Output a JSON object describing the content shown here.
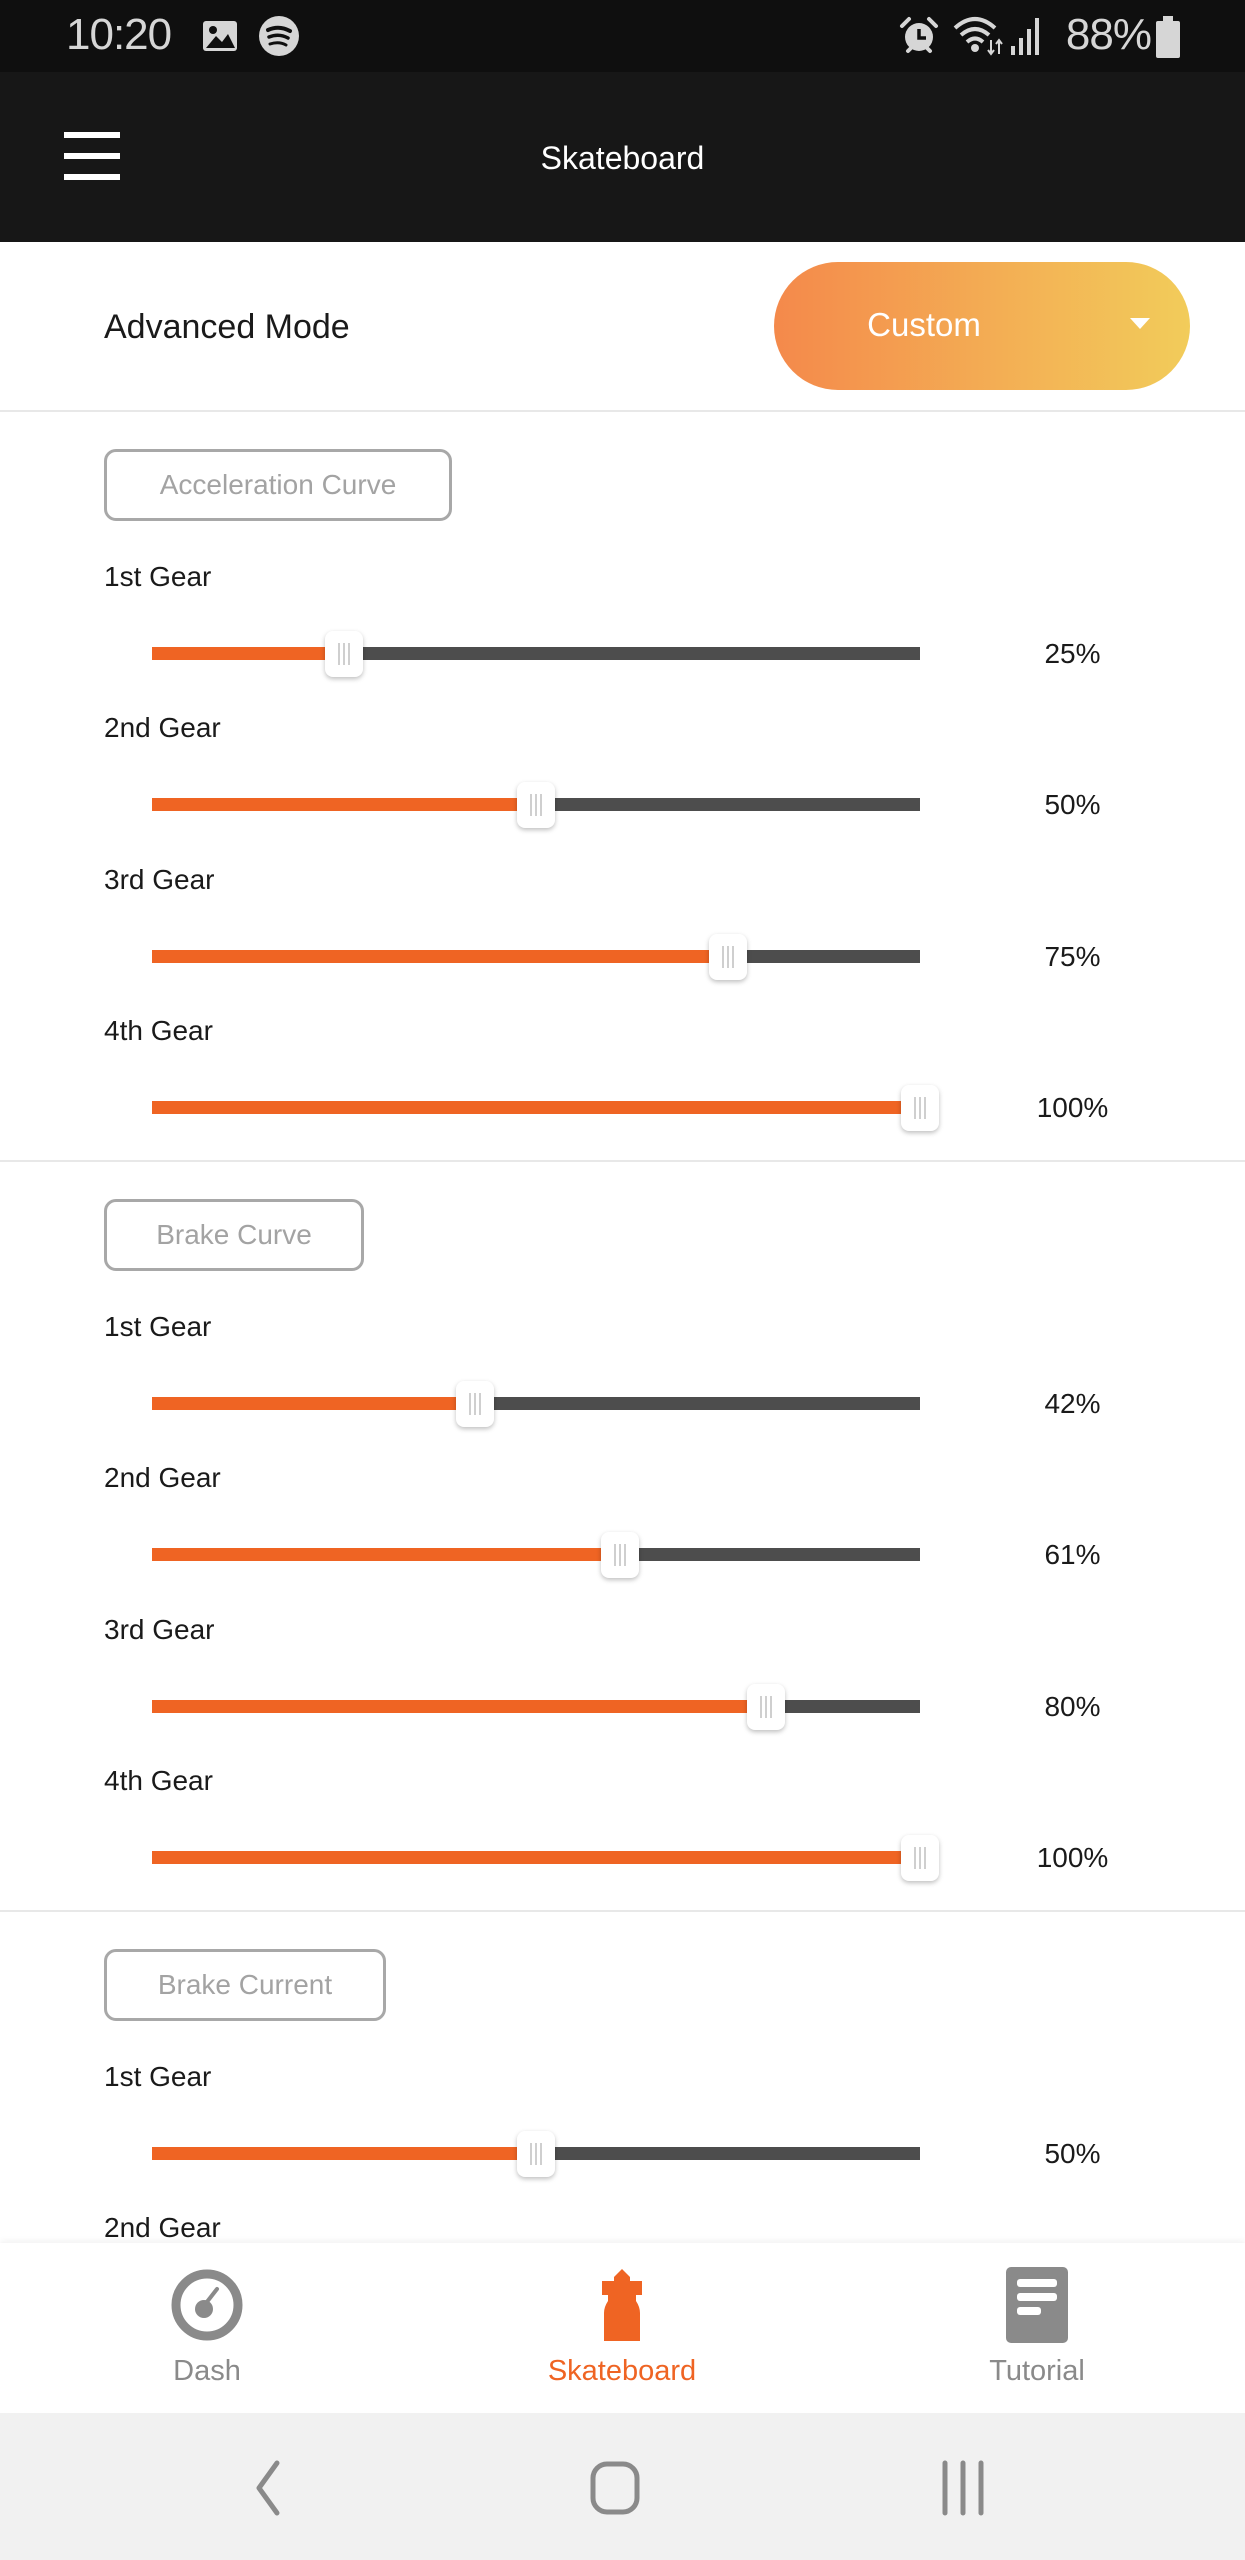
{
  "status_bar": {
    "time": "10:20",
    "battery_percent": "88%",
    "icons": [
      "gallery-icon",
      "spotify-icon",
      "alarm-icon",
      "wifi-icon",
      "signal-icon",
      "battery-icon"
    ]
  },
  "app_bar": {
    "title": "Skateboard",
    "menu_icon": "hamburger-menu-icon"
  },
  "advanced_mode": {
    "label": "Advanced Mode",
    "selected": "Custom"
  },
  "colors": {
    "accent": "#ef6423",
    "track": "#4d4d4d",
    "gradient_start": "#f4894b",
    "gradient_end": "#f2cc5a",
    "inactive": "#8a8a8a"
  },
  "sections": [
    {
      "title": "Acceleration Curve",
      "gears": [
        {
          "label": "1st Gear",
          "value": 25,
          "value_text": "25%"
        },
        {
          "label": "2nd Gear",
          "value": 50,
          "value_text": "50%"
        },
        {
          "label": "3rd Gear",
          "value": 75,
          "value_text": "75%"
        },
        {
          "label": "4th Gear",
          "value": 100,
          "value_text": "100%"
        }
      ]
    },
    {
      "title": "Brake Curve",
      "gears": [
        {
          "label": "1st Gear",
          "value": 42,
          "value_text": "42%"
        },
        {
          "label": "2nd Gear",
          "value": 61,
          "value_text": "61%"
        },
        {
          "label": "3rd Gear",
          "value": 80,
          "value_text": "80%"
        },
        {
          "label": "4th Gear",
          "value": 100,
          "value_text": "100%"
        }
      ]
    },
    {
      "title": "Brake Current",
      "gears": [
        {
          "label": "1st Gear",
          "value": 50,
          "value_text": "50%"
        },
        {
          "label": "2nd Gear"
        }
      ]
    }
  ],
  "bottom_nav": {
    "items": [
      {
        "label": "Dash",
        "icon": "speedometer-icon",
        "active": false
      },
      {
        "label": "Skateboard",
        "icon": "skateboard-icon",
        "active": true
      },
      {
        "label": "Tutorial",
        "icon": "document-icon",
        "active": false
      }
    ]
  },
  "system_nav": {
    "buttons": [
      "back-icon",
      "home-icon",
      "recents-icon"
    ]
  }
}
